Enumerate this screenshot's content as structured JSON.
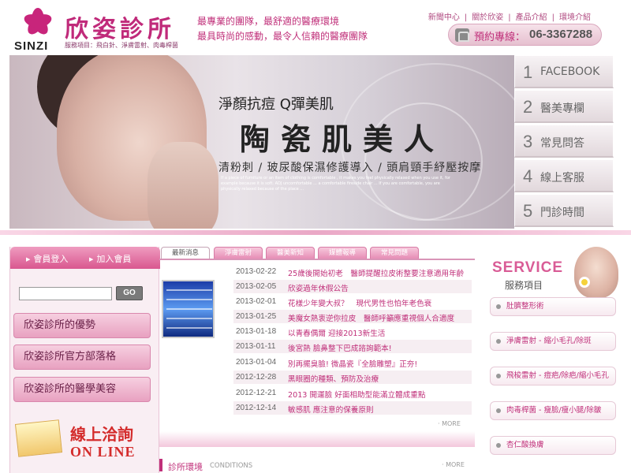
{
  "brand": {
    "logo_text": "SINZI",
    "name": "欣姿診所",
    "services_line": "服務項目：飛白針、淨膚雷射、肉毒桿菌"
  },
  "slogan": {
    "line1": "最專業的團隊，最舒適的醫療環境",
    "line2": "最具時尚的感動，最令人信賴的醫療團隊"
  },
  "top_nav": [
    "新聞中心",
    "關於欣姿",
    "產品介紹",
    "環境介紹"
  ],
  "top_nav_separator": "|",
  "phone": {
    "label": "預約專線：",
    "number": "06-3367288"
  },
  "banner": {
    "headline": "淨顏抗痘  Q彈美肌",
    "big_text": "陶瓷肌美人",
    "subline": "清粉刺 / 玻尿酸保濕修護導入 / 頭肩頸手紓壓按摩",
    "fine_print": "If a piece of furniture or an item of clothing is comfortable , it makes you feel physically relaxed when you use it, for example because it is soft. ADJ uncomfortable ... a comfortable fireside chair ... If you are comfortable, you are physically relaxed because of the place ..."
  },
  "right_menu": [
    {
      "num": "1",
      "label": "FACEBOOK"
    },
    {
      "num": "2",
      "label": "醫美專欄"
    },
    {
      "num": "3",
      "label": "常見問答"
    },
    {
      "num": "4",
      "label": "線上客服"
    },
    {
      "num": "5",
      "label": "門診時間"
    }
  ],
  "sidebar": {
    "login": "會員登入",
    "join": "加入會員",
    "input_value": "",
    "go": "GO",
    "buttons": [
      "欣姿診所的優勢",
      "欣姿診所官方部落格",
      "欣姿診所的醫學美容"
    ],
    "online_cn": "線上洽詢",
    "online_en": "ON LINE"
  },
  "news": {
    "tabs": [
      "最新消息",
      "淨膚雷射",
      "醫美新知",
      "媒體報導",
      "常見問題"
    ],
    "active_tab": 0,
    "items": [
      {
        "date": "2013-02-22",
        "title": "25歲後開始初老　醫師提醒拉皮術整要注意適用年齡"
      },
      {
        "date": "2013-02-05",
        "title": "欣姿過年休假公告"
      },
      {
        "date": "2013-02-01",
        "title": "花樣少年變大叔？　現代男性也怕年老色衰"
      },
      {
        "date": "2013-01-25",
        "title": "美魔女熱衷逆你拉皮　醫師呼籲應重視個人合適度"
      },
      {
        "date": "2013-01-18",
        "title": "以青春偶爾 迎接2013新生活"
      },
      {
        "date": "2013-01-11",
        "title": "後宮熱 臉鼻整下巴成諮詢範本!"
      },
      {
        "date": "2013-01-04",
        "title": "別再擺臭臉! 微晶瓷『全臉雕塑』正夯!"
      },
      {
        "date": "2012-12-28",
        "title": "黑眼圈的種類、預防及治療"
      },
      {
        "date": "2012-12-21",
        "title": "2013 開運臉 好面相助型能滿立體成重點"
      },
      {
        "date": "2012-12-14",
        "title": "敏感肌 應注意的保養原則"
      }
    ],
    "more": "· MORE"
  },
  "conditions": {
    "title": "診所環境",
    "subtitle": "CONDITIONS",
    "more": "· MORE"
  },
  "service": {
    "title_en": "SERVICE",
    "title_cn": "服務項目",
    "items": [
      "肚臍整形術",
      "淨膚雷射 - 縮小毛孔/除斑",
      "飛梭雷射 - 痘疤/除疤/縮小毛孔",
      "肉毒桿菌 - 瘦臉/瘦小腿/除皺",
      "杏仁酸換膚"
    ]
  },
  "colors": {
    "accent": "#c0307a",
    "pink_light": "#f6cfe0",
    "pink_bar": "#d9578f"
  }
}
